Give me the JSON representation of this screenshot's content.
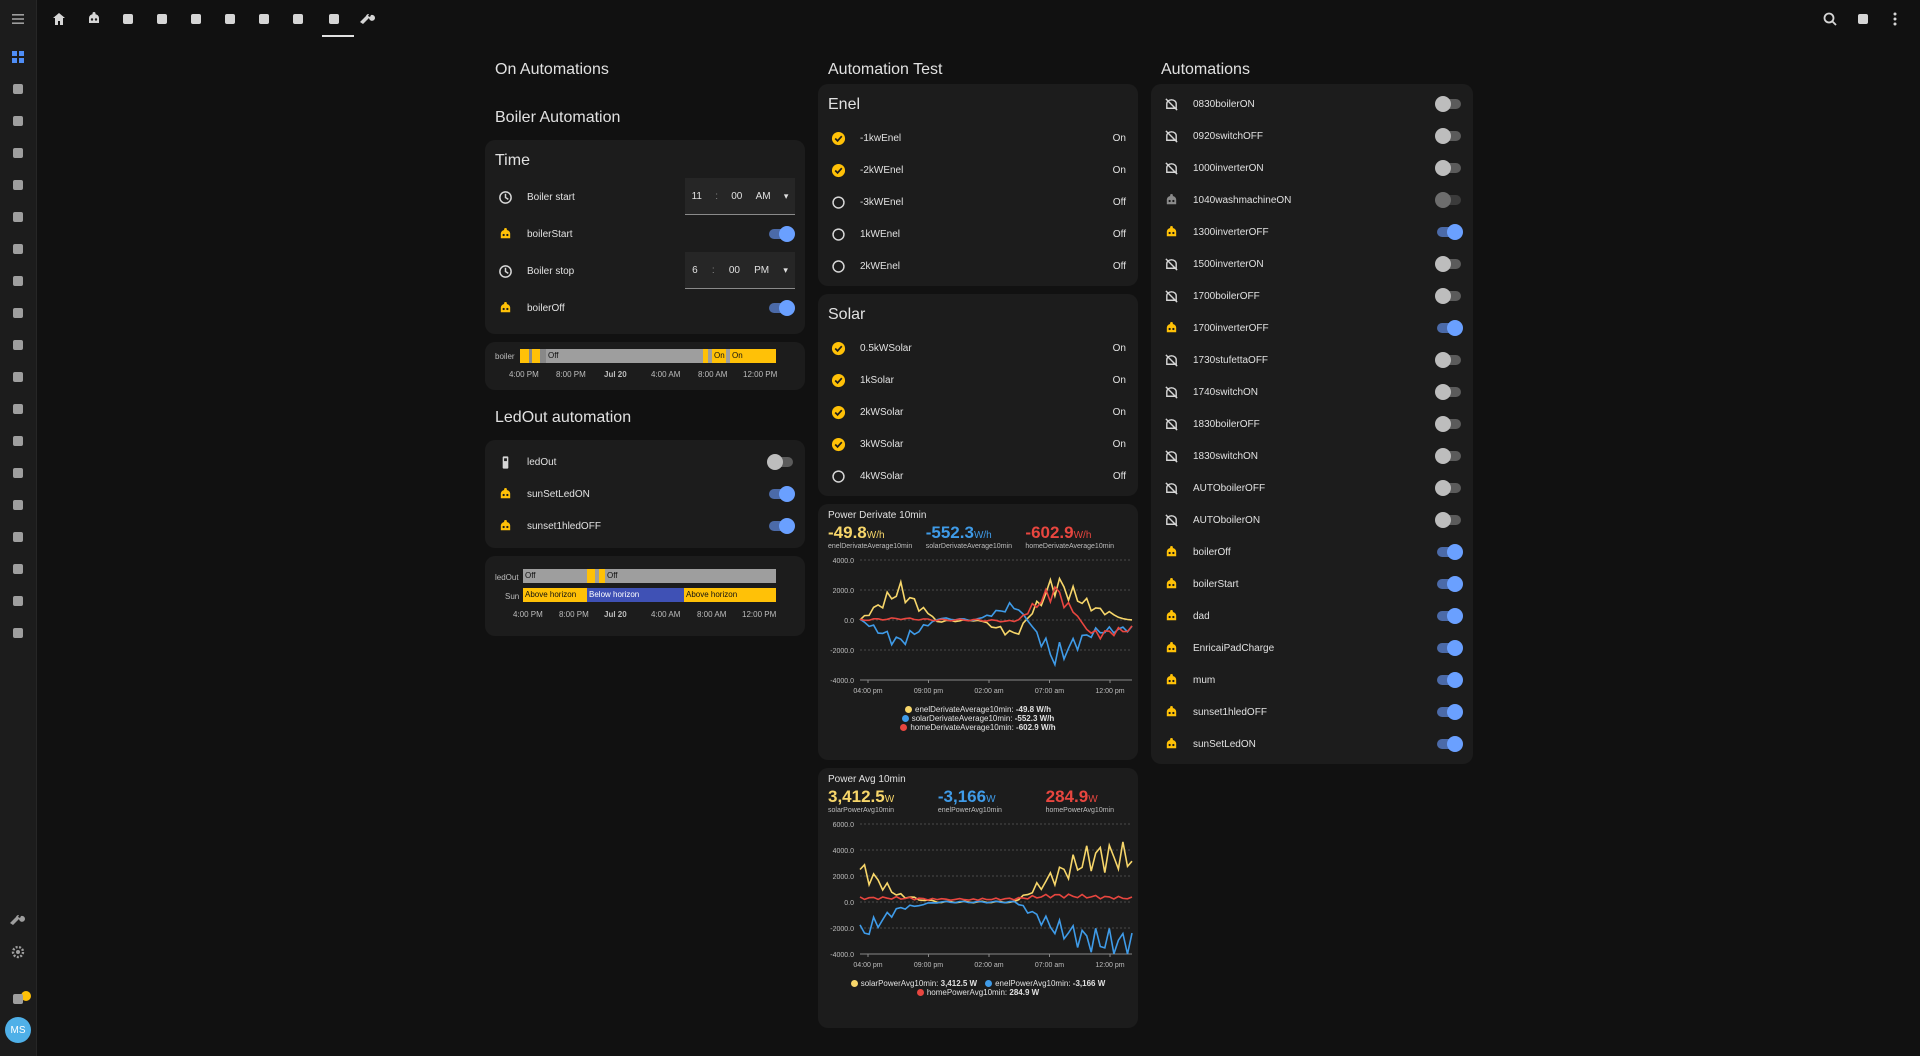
{
  "colors": {
    "accent": "#4f8df6",
    "yellow": "#ffc107",
    "blue": "#3f9be8",
    "red": "#e8463f",
    "yellow_line": "#f7d66a"
  },
  "sidebar": {
    "avatar_initials": "MS",
    "items": [
      "menu-icon",
      "dashboard-icon",
      "energy-icon",
      "logbook-icon",
      "gauge-icon",
      "person-icon",
      "list-icon",
      "history-icon",
      "cloud-icon",
      "strip-icon",
      "gauge-icon-2",
      "person-icon-2",
      "list-icon-2",
      "history-icon-2",
      "cloud-icon-2",
      "store-icon",
      "chart-icon",
      "media-icon",
      "network-icon",
      "vscode-icon",
      "tools-icon",
      "settings-icon",
      "bell-icon"
    ]
  },
  "topbar": {
    "view_icons": [
      "home-icon",
      "robot-icon",
      "weather-icon",
      "network-icon",
      "heater-icon",
      "devices-icon",
      "switch-icon",
      "book-icon",
      "automation-icon",
      "tools-icon"
    ],
    "right_icons": [
      "search-icon",
      "assist-icon",
      "more-icon"
    ]
  },
  "column1": {
    "title": "On Automations",
    "boiler_title": "Boiler Automation",
    "time_card": {
      "title": "Time",
      "rows": [
        {
          "name": "Boiler start",
          "hour": "11",
          "minute": "00",
          "ampm": "AM"
        },
        {
          "name": "boilerStart",
          "on": true
        },
        {
          "name": "Boiler stop",
          "hour": "6",
          "minute": "00",
          "ampm": "PM"
        },
        {
          "name": "boilerOff",
          "on": true
        }
      ]
    },
    "boiler_history": {
      "entity": "boiler",
      "states": [
        "Off",
        "On",
        "On"
      ],
      "ticks": [
        "4:00 PM",
        "8:00 PM",
        "Jul 20",
        "4:00 AM",
        "8:00 AM",
        "12:00 PM"
      ]
    },
    "ledout_title": "LedOut automation",
    "ledout_rows": [
      {
        "name": "ledOut",
        "on": false,
        "icon": "remote-icon"
      },
      {
        "name": "sunSetLedON",
        "on": true,
        "icon": "robot-icon"
      },
      {
        "name": "sunset1hledOFF",
        "on": true,
        "icon": "robot-icon"
      }
    ],
    "ledout_history": {
      "entities": [
        "ledOut",
        "Sun"
      ],
      "led_states": [
        "Off",
        "Off"
      ],
      "sun_states": [
        "Above horizon",
        "Below horizon",
        "Above horizon"
      ],
      "ticks": [
        "4:00 PM",
        "8:00 PM",
        "Jul 20",
        "4:00 AM",
        "8:00 AM",
        "12:00 PM"
      ]
    }
  },
  "column2": {
    "title": "Automation Test",
    "enel": {
      "title": "Enel",
      "rows": [
        {
          "name": "-1kwEnel",
          "state": "On",
          "checked": true
        },
        {
          "name": "-2kWEnel",
          "state": "On",
          "checked": true
        },
        {
          "name": "-3kWEnel",
          "state": "Off",
          "checked": false
        },
        {
          "name": "1kWEnel",
          "state": "Off",
          "checked": false
        },
        {
          "name": "2kWEnel",
          "state": "Off",
          "checked": false
        }
      ]
    },
    "solar": {
      "title": "Solar",
      "rows": [
        {
          "name": "0.5kWSolar",
          "state": "On",
          "checked": true
        },
        {
          "name": "1kSolar",
          "state": "On",
          "checked": true
        },
        {
          "name": "2kWSolar",
          "state": "On",
          "checked": true
        },
        {
          "name": "3kWSolar",
          "state": "On",
          "checked": true
        },
        {
          "name": "4kWSolar",
          "state": "Off",
          "checked": false
        }
      ]
    },
    "power_derivate": {
      "title": "Power Derivate 10min",
      "gauges": [
        {
          "value": "-49.8",
          "unit": "W/h",
          "name": "enelDerivateAverage10min",
          "color": "#f7d66a"
        },
        {
          "value": "-552.3",
          "unit": "W/h",
          "name": "solarDerivateAverage10min",
          "color": "#3f9be8"
        },
        {
          "value": "-602.9",
          "unit": "W/h",
          "name": "homeDerivateAverage10min",
          "color": "#e8463f"
        }
      ],
      "yticks": [
        "4000.0",
        "2000.0",
        "0.0",
        "-2000.0",
        "-4000.0"
      ],
      "xticks": [
        "04:00 pm",
        "09:00 pm",
        "02:00 am",
        "07:00 am",
        "12:00 pm"
      ],
      "legend": [
        {
          "label": "enelDerivateAverage10min:",
          "value": "-49.8 W/h",
          "color": "#f7d66a"
        },
        {
          "label": "solarDerivateAverage10min:",
          "value": "-552.3 W/h",
          "color": "#3f9be8"
        },
        {
          "label": "homeDerivateAverage10min:",
          "value": "-602.9 W/h",
          "color": "#e8463f"
        }
      ]
    },
    "power_avg": {
      "title": "Power Avg 10min",
      "gauges": [
        {
          "value": "3,412.5",
          "unit": "W",
          "name": "solarPowerAvg10min",
          "color": "#f7d66a"
        },
        {
          "value": "-3,166",
          "unit": "W",
          "name": "enelPowerAvg10min",
          "color": "#3f9be8"
        },
        {
          "value": "284.9",
          "unit": "W",
          "name": "homePowerAvg10min",
          "color": "#e8463f"
        }
      ],
      "yticks": [
        "6000.0",
        "4000.0",
        "2000.0",
        "0.0",
        "-2000.0",
        "-4000.0"
      ],
      "xticks": [
        "04:00 pm",
        "09:00 pm",
        "02:00 am",
        "07:00 am",
        "12:00 pm"
      ],
      "legend": [
        {
          "label": "solarPowerAvg10min:",
          "value": "3,412.5 W",
          "color": "#f7d66a"
        },
        {
          "label": "enelPowerAvg10min:",
          "value": "-3,166 W",
          "color": "#3f9be8"
        },
        {
          "label": "homePowerAvg10min:",
          "value": "284.9 W",
          "color": "#e8463f"
        }
      ]
    }
  },
  "chart_data": [
    {
      "type": "line",
      "title": "Power Derivate 10min",
      "x": [
        "04:00 pm",
        "09:00 pm",
        "02:00 am",
        "07:00 am",
        "12:00 pm"
      ],
      "ylim": [
        -4000,
        4000
      ],
      "series": [
        {
          "name": "enelDerivateAverage10min",
          "values": [
            0,
            2000,
            -100,
            0,
            -1000,
            2500,
            800,
            -49.8
          ]
        },
        {
          "name": "solarDerivateAverage10min",
          "values": [
            0,
            -1500,
            100,
            0,
            1000,
            -2500,
            -800,
            -552.3
          ]
        },
        {
          "name": "homeDerivateAverage10min",
          "values": [
            0,
            100,
            0,
            0,
            -100,
            2000,
            -1000,
            -602.9
          ]
        }
      ]
    },
    {
      "type": "line",
      "title": "Power Avg 10min",
      "x": [
        "04:00 pm",
        "09:00 pm",
        "02:00 am",
        "07:00 am",
        "12:00 pm"
      ],
      "ylim": [
        -4000,
        6000
      ],
      "series": [
        {
          "name": "solarPowerAvg10min",
          "values": [
            2500,
            500,
            0,
            0,
            0,
            2000,
            3500,
            3412.5
          ]
        },
        {
          "name": "enelPowerAvg10min",
          "values": [
            -2500,
            -500,
            0,
            0,
            0,
            -2000,
            -3000,
            -3166
          ]
        },
        {
          "name": "homePowerAvg10min",
          "values": [
            300,
            300,
            200,
            200,
            250,
            500,
            400,
            284.9
          ]
        }
      ]
    }
  ],
  "column3": {
    "title": "Automations",
    "rows": [
      {
        "name": "0830boilerON",
        "on": false,
        "icon": "robot-off-icon"
      },
      {
        "name": "0920switchOFF",
        "on": false,
        "icon": "robot-off-icon"
      },
      {
        "name": "1000inverterON",
        "on": false,
        "icon": "robot-off-icon"
      },
      {
        "name": "1040washmachineON",
        "on": false,
        "icon": "robot-gray-icon",
        "dim": true
      },
      {
        "name": "1300inverterOFF",
        "on": true,
        "icon": "robot-icon"
      },
      {
        "name": "1500inverterON",
        "on": false,
        "icon": "robot-off-icon"
      },
      {
        "name": "1700boilerOFF",
        "on": false,
        "icon": "robot-off-icon"
      },
      {
        "name": "1700inverterOFF",
        "on": true,
        "icon": "robot-icon"
      },
      {
        "name": "1730stufettaOFF",
        "on": false,
        "icon": "robot-off-icon"
      },
      {
        "name": "1740switchON",
        "on": false,
        "icon": "robot-off-icon"
      },
      {
        "name": "1830boilerOFF",
        "on": false,
        "icon": "robot-off-icon"
      },
      {
        "name": "1830switchON",
        "on": false,
        "icon": "robot-off-icon"
      },
      {
        "name": "AUTOboilerOFF",
        "on": false,
        "icon": "robot-off-icon"
      },
      {
        "name": "AUTOboilerON",
        "on": false,
        "icon": "robot-off-icon"
      },
      {
        "name": "boilerOff",
        "on": true,
        "icon": "robot-icon"
      },
      {
        "name": "boilerStart",
        "on": true,
        "icon": "robot-icon"
      },
      {
        "name": "dad",
        "on": true,
        "icon": "robot-icon"
      },
      {
        "name": "EnricaiPadCharge",
        "on": true,
        "icon": "robot-icon"
      },
      {
        "name": "mum",
        "on": true,
        "icon": "robot-icon"
      },
      {
        "name": "sunset1hledOFF",
        "on": true,
        "icon": "robot-icon"
      },
      {
        "name": "sunSetLedON",
        "on": true,
        "icon": "robot-icon"
      }
    ]
  }
}
